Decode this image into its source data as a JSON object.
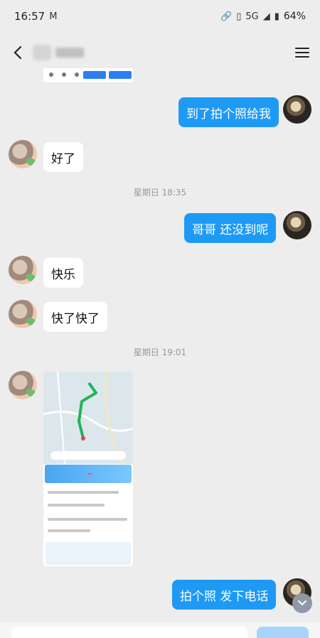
{
  "status_bar": {
    "time": "16:57",
    "notification_icon": "M",
    "network": "5G",
    "battery": "64%"
  },
  "header": {
    "contact_name_obscured": true
  },
  "messages": [
    {
      "id": "m1",
      "side": "out",
      "text": "到了拍个照给我"
    },
    {
      "id": "m2",
      "side": "in",
      "text": "好了"
    },
    {
      "id": "ts1",
      "type": "timestamp",
      "text": "星期日 18:35"
    },
    {
      "id": "m3",
      "side": "out",
      "text": "哥哥  还没到呢"
    },
    {
      "id": "m4",
      "side": "in",
      "text": "快乐"
    },
    {
      "id": "m5",
      "side": "in",
      "text": "快了快了"
    },
    {
      "id": "ts2",
      "type": "timestamp",
      "text": "星期日 19:01"
    },
    {
      "id": "m6",
      "side": "in",
      "type": "image",
      "text": ""
    },
    {
      "id": "m7",
      "side": "out",
      "text": "拍个照  发下电话"
    }
  ],
  "icons": {
    "back": "chevron-left-icon",
    "menu": "hamburger-menu-icon",
    "scroll_down": "chevron-down-icon"
  },
  "colors": {
    "outgoing_bubble": "#1e9af5",
    "incoming_bubble": "#ffffff",
    "background": "#ededed"
  }
}
